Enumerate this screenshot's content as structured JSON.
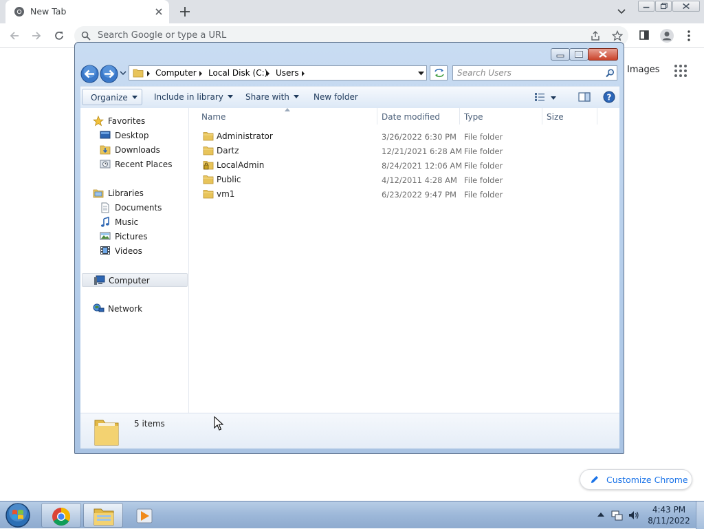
{
  "chrome": {
    "tab_title": "New Tab",
    "omnibox_placeholder": "Search Google or type a URL",
    "images_link": "Images",
    "customize_label": "Customize Chrome"
  },
  "explorer": {
    "breadcrumbs": [
      "Computer",
      "Local Disk (C:)",
      "Users"
    ],
    "search_placeholder": "Search Users",
    "commands": {
      "organize": "Organize",
      "include_in_library": "Include in library",
      "share_with": "Share with",
      "new_folder": "New folder"
    },
    "nav": {
      "favorites": "Favorites",
      "desktop": "Desktop",
      "downloads": "Downloads",
      "recent_places": "Recent Places",
      "libraries": "Libraries",
      "documents": "Documents",
      "music": "Music",
      "pictures": "Pictures",
      "videos": "Videos",
      "computer": "Computer",
      "network": "Network"
    },
    "columns": {
      "name": "Name",
      "date_modified": "Date modified",
      "type": "Type",
      "size": "Size"
    },
    "files": [
      {
        "name": "Administrator",
        "date": "3/26/2022 6:30 PM",
        "type": "File folder",
        "icon": "folder-icon"
      },
      {
        "name": "Dartz",
        "date": "12/21/2021 6:28 AM",
        "type": "File folder",
        "icon": "folder-icon"
      },
      {
        "name": "LocalAdmin",
        "date": "8/24/2021 12:06 AM",
        "type": "File folder",
        "icon": "locked-folder-icon"
      },
      {
        "name": "Public",
        "date": "4/12/2011 4:28 AM",
        "type": "File folder",
        "icon": "folder-icon"
      },
      {
        "name": "vm1",
        "date": "6/23/2022 9:47 PM",
        "type": "File folder",
        "icon": "folder-icon"
      }
    ],
    "status_text": "5 items"
  },
  "taskbar": {
    "time": "4:43 PM",
    "date": "8/11/2022"
  },
  "colors": {
    "chrome_accent": "#1a73e8",
    "explorer_frame": "#b4cdea",
    "taskbar": "#9db8d9",
    "folder": "#e8c45a"
  }
}
